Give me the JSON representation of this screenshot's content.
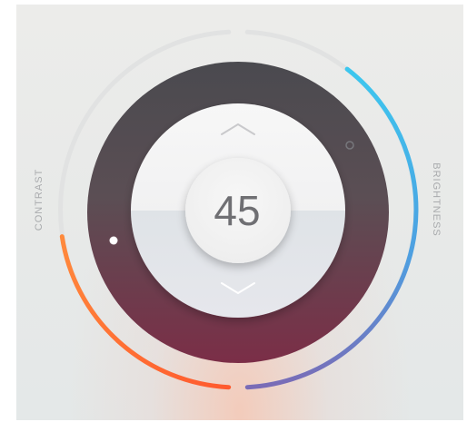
{
  "dial": {
    "value": "45",
    "contrast_label": "CONTRAST",
    "brightness_label": "BRIGHTNESS",
    "contrast_level": 0.45,
    "brightness_level": 0.8
  },
  "icons": {
    "increase": "chevron-up-icon",
    "decrease": "chevron-down-icon",
    "active_indicator": "dot-indicator",
    "inactive_indicator": "ring-indicator"
  },
  "colors": {
    "contrast_arc_start": "#ff8a3c",
    "contrast_arc_end": "#ff5a2e",
    "brightness_arc_start": "#3cc7ef",
    "brightness_arc_end": "#7a6bb6",
    "outer_ring": "#e0e1e1",
    "dial_dark": "#4b4a4f",
    "dial_wine": "#7a2f45"
  }
}
